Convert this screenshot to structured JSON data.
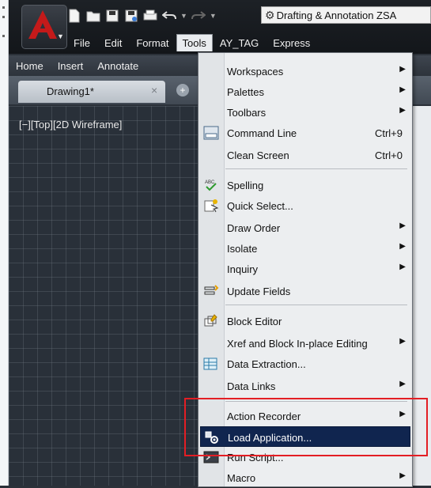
{
  "window": {
    "workspace_selector": "Drafting & Annotation ZSA",
    "menubar": [
      "File",
      "Edit",
      "Format",
      "Tools",
      "AY_TAG",
      "Express"
    ],
    "ribbon_tabs": [
      "Home",
      "Insert",
      "Annotate"
    ],
    "doc_tab": "Drawing1*",
    "doc_tab_close": "×",
    "new_tab": "+",
    "viewport_label": "[−][Top][2D Wireframe]"
  },
  "tools_menu": {
    "items": [
      {
        "label": "Workspaces",
        "arrow": "▶"
      },
      {
        "label": "Palettes",
        "arrow": "▶"
      },
      {
        "label": "Toolbars",
        "arrow": "▶"
      },
      {
        "label": "Command Line",
        "shortcut": "Ctrl+9",
        "icon": "command-line-icon"
      },
      {
        "label": "Clean Screen",
        "shortcut": "Ctrl+0"
      },
      {
        "label": "Spelling",
        "icon": "spelling-icon"
      },
      {
        "label": "Quick Select...",
        "icon": "quick-select-icon"
      },
      {
        "label": "Draw Order",
        "arrow": "▶"
      },
      {
        "label": "Isolate",
        "arrow": "▶"
      },
      {
        "label": "Inquiry",
        "arrow": "▶"
      },
      {
        "label": "Update Fields",
        "icon": "update-fields-icon"
      },
      {
        "label": "Block Editor",
        "icon": "block-editor-icon"
      },
      {
        "label": "Xref and Block In-place Editing",
        "arrow": "▶"
      },
      {
        "label": "Data Extraction...",
        "icon": "data-extraction-icon"
      },
      {
        "label": "Data Links",
        "arrow": "▶"
      },
      {
        "label": "Action Recorder",
        "arrow": "▶"
      },
      {
        "label": "Load Application...",
        "icon": "load-application-icon",
        "highlighted": true
      },
      {
        "label": "Run Script...",
        "icon": "run-script-icon"
      },
      {
        "label": "Macro",
        "arrow": "▶"
      }
    ]
  },
  "colors": {
    "highlight": "#10254f",
    "annotation_box": "#e31e24",
    "app_logo": "#c41a1a"
  }
}
